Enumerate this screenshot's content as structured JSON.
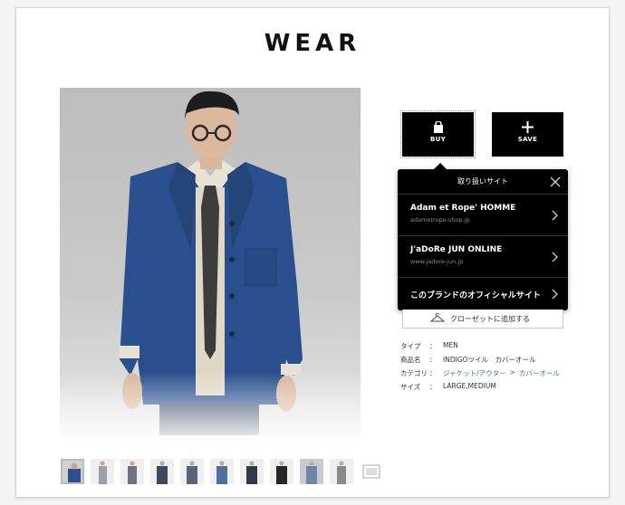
{
  "logo": "WEAR",
  "actions": {
    "buy_label": "BUY",
    "save_label": "SAVE"
  },
  "popup": {
    "title": "取り扱いサイト",
    "items": [
      {
        "name": "Adam et Rope' HOMME",
        "url": "adametrope-shop.jp"
      },
      {
        "name": "J'aDoRe JUN ONLINE",
        "url": "www.jadore-jun.jp"
      },
      {
        "name": "このブランドのオフィシャルサイト",
        "url": ""
      }
    ]
  },
  "closet_label": "クローゼットに追加する",
  "info": {
    "type_key": "タイプ",
    "type_val": "MEN",
    "product_key": "商品名",
    "product_val": "INDIGOツイル　カバーオール",
    "category_key": "カテゴリ",
    "category_parent": "ジャケット/アウター",
    "category_arrow": ">",
    "category_child": "カバーオール",
    "size_key": "サイズ",
    "size_val": "LARGE,MEDIUM",
    "colon": "："
  },
  "colors": {
    "accent_black": "#000000",
    "link": "#3f6ea8"
  },
  "thumbnails_count": 11
}
